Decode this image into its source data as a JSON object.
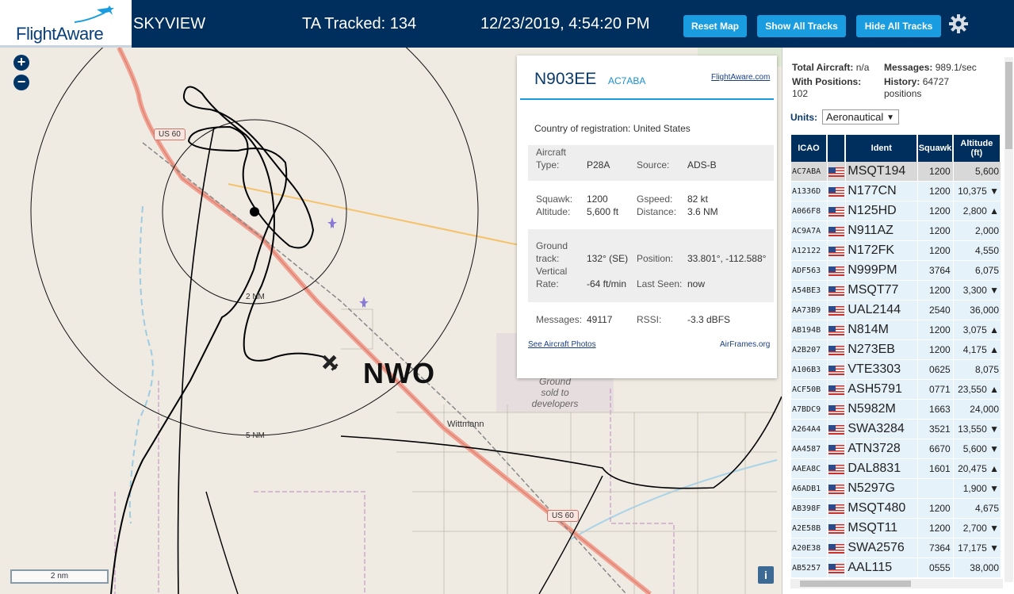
{
  "header": {
    "brand": "FlightAware",
    "title": "SKYVIEW",
    "tracked": "TA Tracked: 134",
    "clock": "12/23/2019, 4:54:20 PM",
    "buttons": {
      "reset": "Reset Map",
      "show_all": "Show All Tracks",
      "hide_all": "Hide All Tracks"
    },
    "settings_icon": "gear-icon"
  },
  "map": {
    "zoom_in": "+",
    "zoom_out": "−",
    "scale": "2 nm",
    "info": "i",
    "range_labels": [
      "2 NM",
      "5 NM"
    ],
    "road_signs": [
      "US 60",
      "US 60"
    ],
    "airport": "NWO",
    "area_label": "Ground sold to developers",
    "town": "Wittmann"
  },
  "popup": {
    "ident": "N903EE",
    "icao": "AC7ABA",
    "link": "FlightAware.com",
    "country_label": "Country of registration:",
    "country": "United States",
    "aircraft_type_label": "Aircraft Type:",
    "aircraft_type_line1": "Aircraft",
    "aircraft_type_line2": "Type:",
    "aircraft_type": "P28A",
    "source_label": "Source:",
    "source": "ADS-B",
    "squawk_label": "Squawk:",
    "squawk": "1200",
    "gspeed_label": "Gspeed:",
    "gspeed": "82 kt",
    "altitude_label": "Altitude:",
    "altitude": "5,600 ft",
    "distance_label": "Distance:",
    "distance": "3.6 NM",
    "ground_line1": "Ground",
    "ground_line2": "track:",
    "ground_track": "132° (SE)",
    "position_label": "Position:",
    "position": "33.801°, -112.588°",
    "vrate_line1": "Vertical",
    "vrate_line2": "Rate:",
    "vertical_rate": "-64 ft/min",
    "last_seen_label": "Last Seen:",
    "last_seen": "now",
    "messages_label": "Messages:",
    "messages": "49117",
    "rssi_label": "RSSI:",
    "rssi": "-3.3 dBFS",
    "photos_link": "See Aircraft Photos",
    "airframes_link": "AirFrames.org"
  },
  "sidebar": {
    "total_label": "Total Aircraft:",
    "total": "n/a",
    "messages_label": "Messages:",
    "messages": "989.1/sec",
    "positions_label": "With Positions:",
    "positions": "102",
    "history_label": "History:",
    "history_l1": "64727",
    "history_l2": "positions",
    "units_label": "Units:",
    "units_value": "Aeronautical",
    "columns": [
      "ICAO",
      "",
      "Ident",
      "Squawk",
      "Altitude (ft)"
    ],
    "col_alt_l1": "Altitude",
    "col_alt_l2": "(ft)",
    "rows": [
      {
        "icao": "AC7ABA",
        "ident": "MSQT194",
        "squawk": "1200",
        "alt": "5,600",
        "selected": true
      },
      {
        "icao": "A1336D",
        "ident": "N177CN",
        "squawk": "1200",
        "alt": "10,375 ▼"
      },
      {
        "icao": "A066F8",
        "ident": "N125HD",
        "squawk": "1200",
        "alt": "2,800 ▲"
      },
      {
        "icao": "AC9A7A",
        "ident": "N911AZ",
        "squawk": "1200",
        "alt": "2,000"
      },
      {
        "icao": "A12122",
        "ident": "N172FK",
        "squawk": "1200",
        "alt": "4,550"
      },
      {
        "icao": "ADF563",
        "ident": "N999PM",
        "squawk": "3764",
        "alt": "6,075"
      },
      {
        "icao": "A54BE3",
        "ident": "MSQT77",
        "squawk": "1200",
        "alt": "3,300 ▼"
      },
      {
        "icao": "AA73B9",
        "ident": "UAL2144",
        "squawk": "2540",
        "alt": "36,000"
      },
      {
        "icao": "AB194B",
        "ident": "N814M",
        "squawk": "1200",
        "alt": "3,075 ▲"
      },
      {
        "icao": "A2B207",
        "ident": "N273EB",
        "squawk": "1200",
        "alt": "4,175 ▲"
      },
      {
        "icao": "A106B3",
        "ident": "VTE3303",
        "squawk": "0625",
        "alt": "8,075"
      },
      {
        "icao": "ACF50B",
        "ident": "ASH5791",
        "squawk": "0771",
        "alt": "23,550 ▲"
      },
      {
        "icao": "A7BDC9",
        "ident": "N5982M",
        "squawk": "1663",
        "alt": "24,000"
      },
      {
        "icao": "A264A4",
        "ident": "SWA3284",
        "squawk": "3521",
        "alt": "13,550 ▼"
      },
      {
        "icao": "AA4587",
        "ident": "ATN3728",
        "squawk": "6670",
        "alt": "5,600 ▼"
      },
      {
        "icao": "AAEA8C",
        "ident": "DAL8831",
        "squawk": "1601",
        "alt": "20,475 ▲"
      },
      {
        "icao": "A6ADB1",
        "ident": "N5297G",
        "squawk": "",
        "alt": "1,900 ▼"
      },
      {
        "icao": "AB398F",
        "ident": "MSQT480",
        "squawk": "1200",
        "alt": "4,675"
      },
      {
        "icao": "A2E58B",
        "ident": "MSQT11",
        "squawk": "1200",
        "alt": "2,700 ▼"
      },
      {
        "icao": "A20E38",
        "ident": "SWA2576",
        "squawk": "7364",
        "alt": "17,175 ▼"
      },
      {
        "icao": "AB5257",
        "ident": "AAL115",
        "squawk": "0555",
        "alt": "38,000"
      }
    ]
  }
}
